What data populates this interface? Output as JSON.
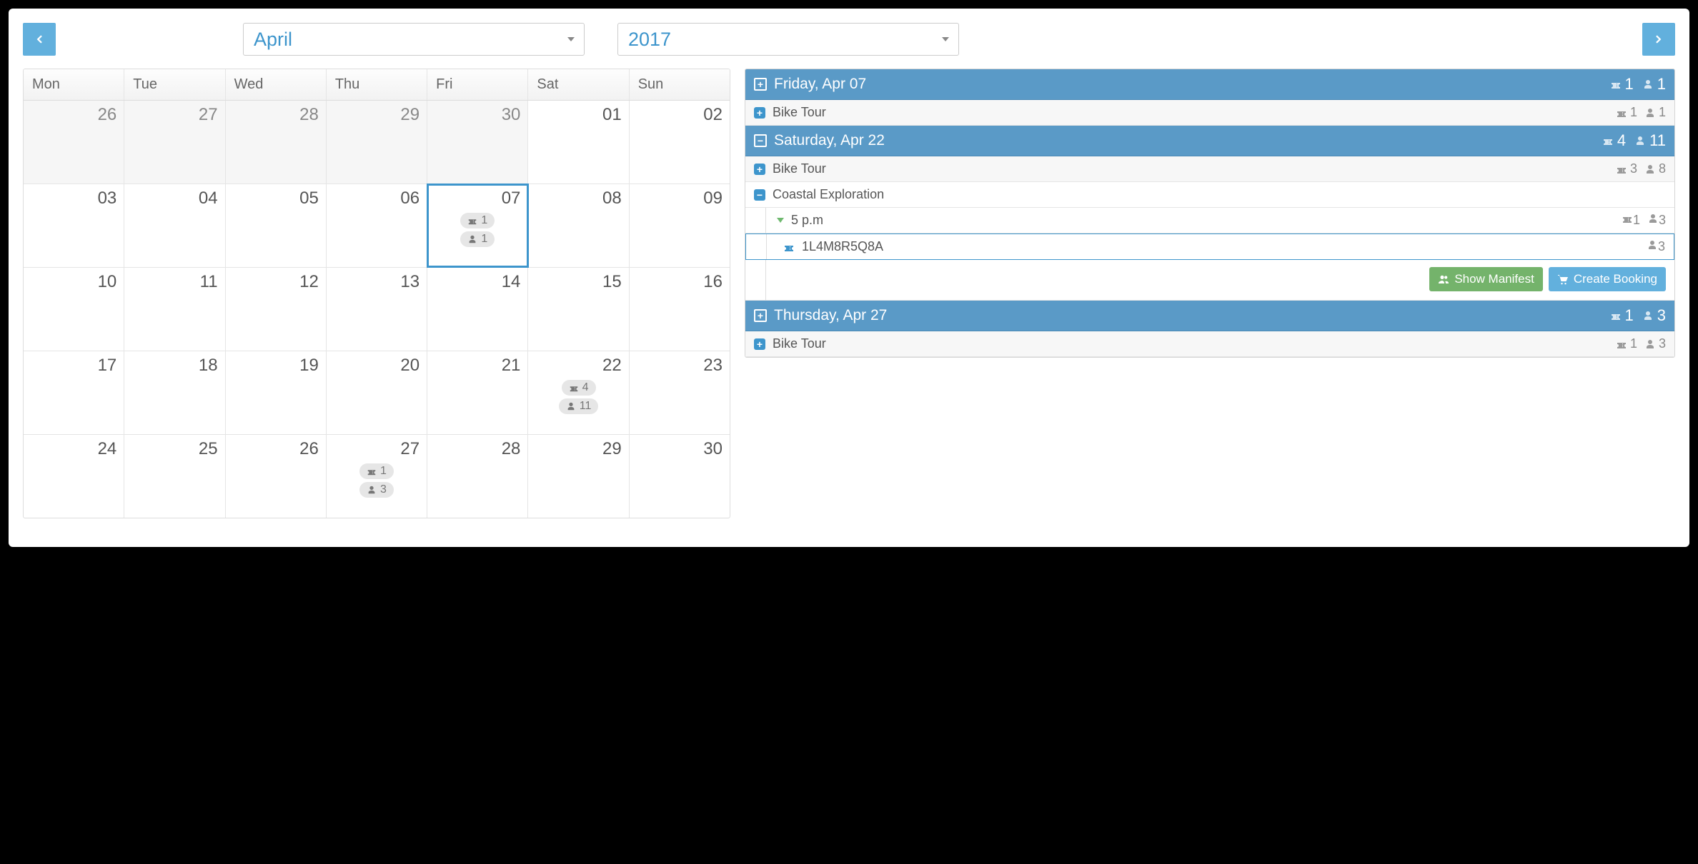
{
  "nav": {
    "month": "April",
    "year": "2017"
  },
  "weekday_labels": [
    "Mon",
    "Tue",
    "Wed",
    "Thu",
    "Fri",
    "Sat",
    "Sun"
  ],
  "grid": [
    [
      {
        "day": "26",
        "outside": true
      },
      {
        "day": "27",
        "outside": true
      },
      {
        "day": "28",
        "outside": true
      },
      {
        "day": "29",
        "outside": true
      },
      {
        "day": "30",
        "outside": true
      },
      {
        "day": "01",
        "outside": false
      },
      {
        "day": "02",
        "outside": false
      }
    ],
    [
      {
        "day": "03"
      },
      {
        "day": "04"
      },
      {
        "day": "05"
      },
      {
        "day": "06"
      },
      {
        "day": "07",
        "selected": true,
        "tickets": "1",
        "people": "1"
      },
      {
        "day": "08"
      },
      {
        "day": "09"
      }
    ],
    [
      {
        "day": "10"
      },
      {
        "day": "11"
      },
      {
        "day": "12"
      },
      {
        "day": "13"
      },
      {
        "day": "14"
      },
      {
        "day": "15"
      },
      {
        "day": "16"
      }
    ],
    [
      {
        "day": "17"
      },
      {
        "day": "18"
      },
      {
        "day": "19"
      },
      {
        "day": "20"
      },
      {
        "day": "21"
      },
      {
        "day": "22",
        "tickets": "4",
        "people": "11"
      },
      {
        "day": "23"
      }
    ],
    [
      {
        "day": "24"
      },
      {
        "day": "25"
      },
      {
        "day": "26"
      },
      {
        "day": "27",
        "tickets": "1",
        "people": "3"
      },
      {
        "day": "28"
      },
      {
        "day": "29"
      },
      {
        "day": "30"
      }
    ]
  ],
  "side": {
    "days": [
      {
        "id": "apr07",
        "label": "Friday, Apr 07",
        "expand": "plus",
        "tickets": "1",
        "people": "1",
        "tours": [
          {
            "name": "Bike Tour",
            "expand": "plus",
            "tickets": "1",
            "people": "1"
          }
        ]
      },
      {
        "id": "apr22",
        "label": "Saturday, Apr 22",
        "expand": "minus",
        "tickets": "4",
        "people": "11",
        "tours": [
          {
            "name": "Bike Tour",
            "expand": "plus",
            "tickets": "3",
            "people": "8"
          },
          {
            "name": "Coastal Exploration",
            "expand": "minus",
            "times": [
              {
                "label": "5 p.m",
                "tickets": "1",
                "people": "3",
                "bookings": [
                  {
                    "code": "1L4M8R5Q8A",
                    "people": "3"
                  }
                ],
                "actions": {
                  "manifest": "Show Manifest",
                  "create": "Create Booking"
                }
              }
            ]
          }
        ]
      },
      {
        "id": "apr27",
        "label": "Thursday, Apr 27",
        "expand": "plus",
        "tickets": "1",
        "people": "3",
        "tours": [
          {
            "name": "Bike Tour",
            "expand": "plus",
            "tickets": "1",
            "people": "3"
          }
        ]
      }
    ]
  }
}
